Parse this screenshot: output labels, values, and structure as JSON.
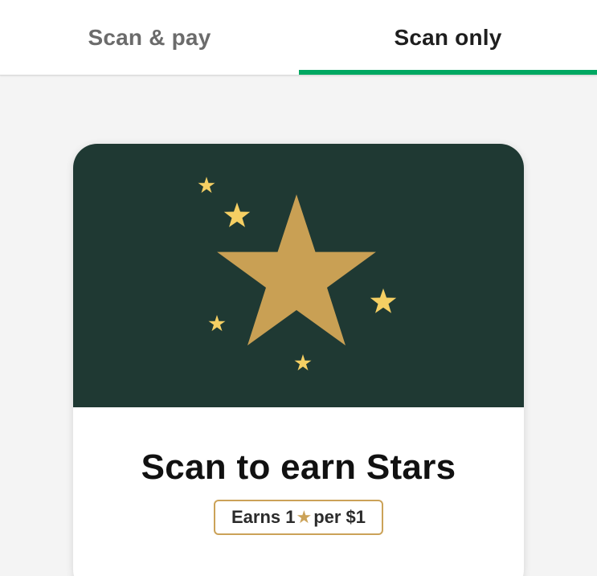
{
  "tabs": [
    {
      "label": "Scan & pay",
      "selected": false
    },
    {
      "label": "Scan only",
      "selected": true
    }
  ],
  "colors": {
    "accent": "#00a862",
    "hero_bg": "#1f3933",
    "gold": "#cba258",
    "sparkle": "#f5cf63"
  },
  "card": {
    "title": "Scan to earn Stars",
    "earn": {
      "prefix": "Earns 1",
      "icon": "star-icon",
      "suffix": "per $1"
    }
  }
}
